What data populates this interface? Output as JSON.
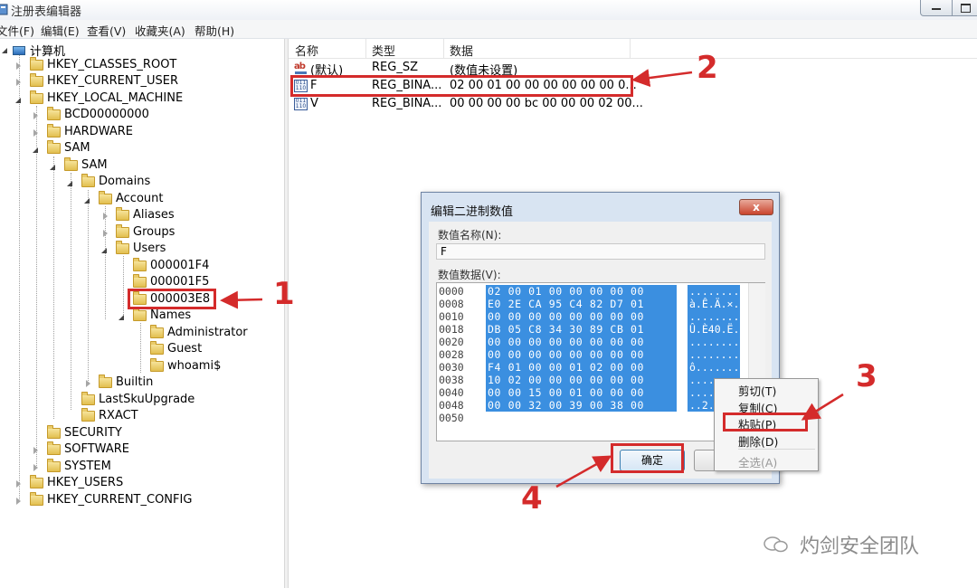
{
  "window": {
    "title": "注册表编辑器"
  },
  "menu": [
    "文件(F)",
    "编辑(E)",
    "查看(V)",
    "收藏夹(A)",
    "帮助(H)"
  ],
  "tree": {
    "root": "计算机",
    "nodes": [
      "HKEY_CLASSES_ROOT",
      "HKEY_CURRENT_USER",
      "HKEY_LOCAL_MACHINE",
      "BCD00000000",
      "HARDWARE",
      "SAM",
      "SAM",
      "Domains",
      "Account",
      "Aliases",
      "Groups",
      "Users",
      "000001F4",
      "000001F5",
      "000003E8",
      "Names",
      "Administrator",
      "Guest",
      "whoami$",
      "Builtin",
      "LastSkuUpgrade",
      "RXACT",
      "SECURITY",
      "SOFTWARE",
      "SYSTEM",
      "HKEY_USERS",
      "HKEY_CURRENT_CONFIG"
    ]
  },
  "list": {
    "headers": {
      "name": "名称",
      "type": "类型",
      "data": "数据"
    },
    "rows": [
      {
        "name": "(默认)",
        "type": "REG_SZ",
        "data": "(数值未设置)"
      },
      {
        "name": "F",
        "type": "REG_BINA...",
        "data": "02 00 01 00 00 00 00 00 00 0..."
      },
      {
        "name": "V",
        "type": "REG_BINA...",
        "data": "00 00 00 00 bc 00 00 00 02 00..."
      }
    ]
  },
  "dialog": {
    "title": "编辑二进制数值",
    "close": "x",
    "name_label": "数值名称(N):",
    "name_value": "F",
    "data_label": "数值数据(V):",
    "hex_rows": [
      {
        "offset": "0000",
        "bytes": "02 00 01 00 00 00 00 00",
        "ascii": "........"
      },
      {
        "offset": "0008",
        "bytes": "E0 2E CA 95 C4 82 D7 01",
        "ascii": "à.Ê.Ä.×."
      },
      {
        "offset": "0010",
        "bytes": "00 00 00 00 00 00 00 00",
        "ascii": "........"
      },
      {
        "offset": "0018",
        "bytes": "DB 05 C8 34 30 89 CB 01",
        "ascii": "Û.È40.Ë."
      },
      {
        "offset": "0020",
        "bytes": "00 00 00 00 00 00 00 00",
        "ascii": "........"
      },
      {
        "offset": "0028",
        "bytes": "00 00 00 00 00 00 00 00",
        "ascii": "........"
      },
      {
        "offset": "0030",
        "bytes": "F4 01 00 00 01 02 00 00",
        "ascii": "ô......."
      },
      {
        "offset": "0038",
        "bytes": "10 02 00 00 00 00 00 00",
        "ascii": "........"
      },
      {
        "offset": "0040",
        "bytes": "00 00 15 00 01 00 00 00",
        "ascii": "........"
      },
      {
        "offset": "0048",
        "bytes": "00 00 32 00 39 00 38 00",
        "ascii": "..2.9.8."
      },
      {
        "offset": "0050",
        "bytes": "",
        "ascii": ""
      }
    ],
    "ok": "确定"
  },
  "context_menu": [
    "剪切(T)",
    "复制(C)",
    "粘贴(P)",
    "删除(D)",
    "全选(A)"
  ],
  "annotations": [
    "1",
    "2",
    "3",
    "4"
  ],
  "watermark": "灼剑安全团队",
  "colors": {
    "annotation_red": "#d42b2b",
    "hex_selection": "#3b8fe0"
  }
}
